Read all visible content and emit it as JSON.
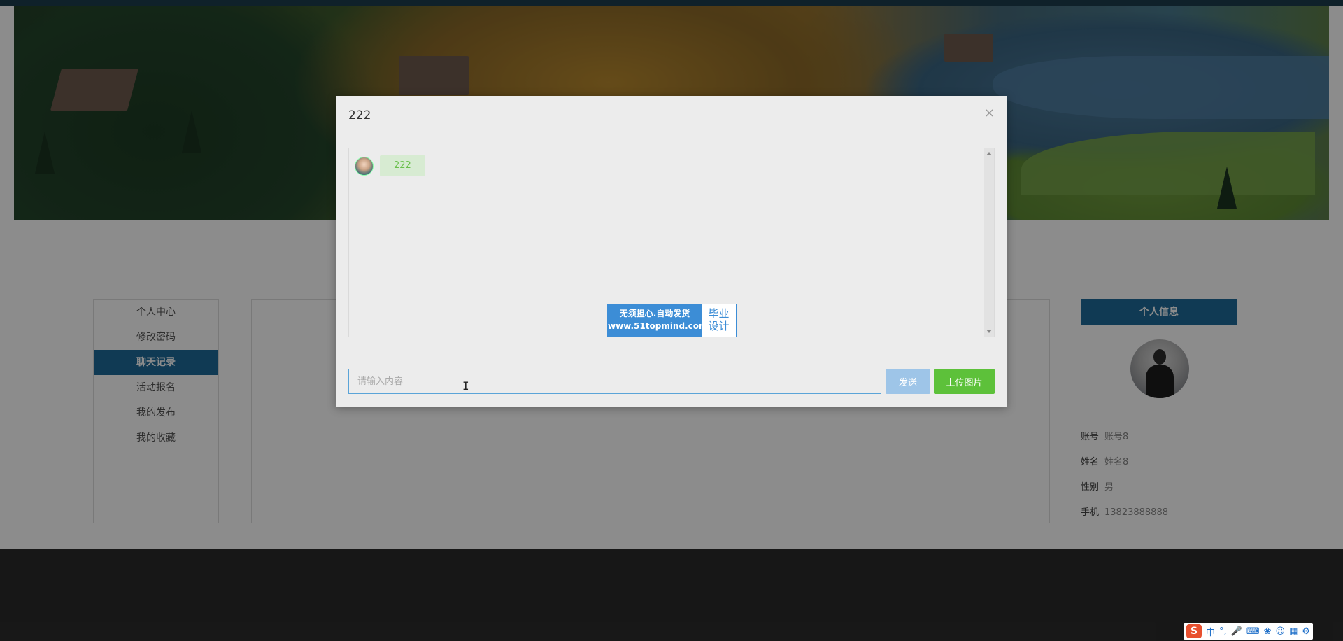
{
  "sidebar": {
    "items": [
      {
        "label": "个人中心"
      },
      {
        "label": "修改密码"
      },
      {
        "label": "聊天记录"
      },
      {
        "label": "活动报名"
      },
      {
        "label": "我的发布"
      },
      {
        "label": "我的收藏"
      }
    ]
  },
  "profile": {
    "title": "个人信息",
    "fields": [
      {
        "label": "账号",
        "value": "账号8"
      },
      {
        "label": "姓名",
        "value": "姓名8"
      },
      {
        "label": "性别",
        "value": "男"
      },
      {
        "label": "手机",
        "value": "13823888888"
      }
    ]
  },
  "modal": {
    "title": "222",
    "close": "×",
    "messages": [
      {
        "text": "222"
      }
    ],
    "input_placeholder": "请输入内容",
    "send_label": "发送",
    "upload_label": "上传图片"
  },
  "watermark": {
    "line1": "无须担心.自动发货",
    "line2": "www.51topmind.com",
    "right1": "毕业",
    "right2": "设计"
  },
  "ime": {
    "logo": "S",
    "mode": "中",
    "punct": "°,"
  },
  "colors": {
    "primary": "#1e6b99",
    "send": "#9ec5e8",
    "upload": "#5dc13a",
    "bubble_text": "#6ac04c"
  }
}
